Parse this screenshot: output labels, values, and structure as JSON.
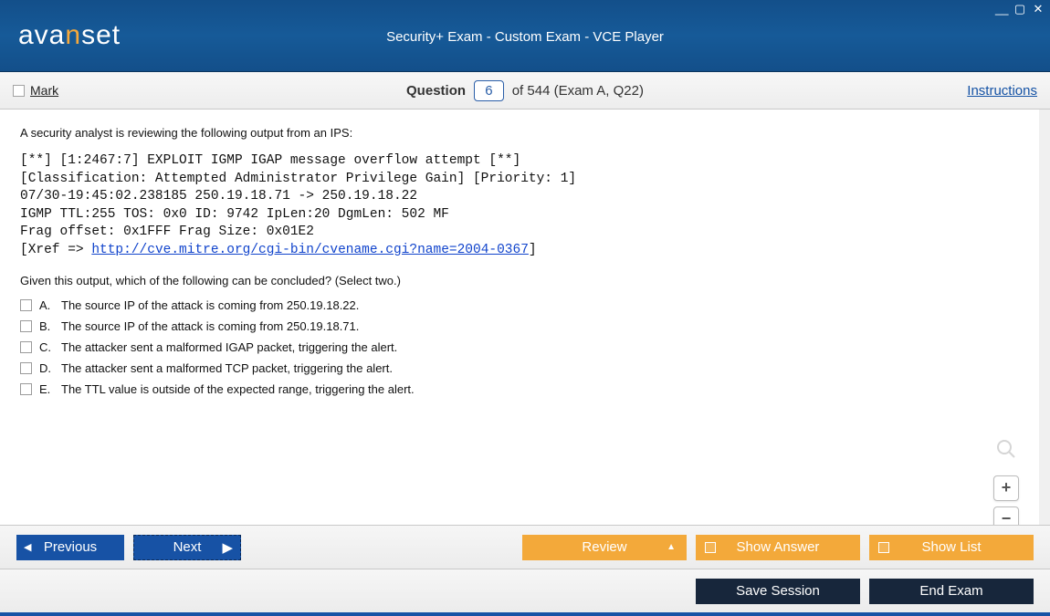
{
  "header": {
    "brand_a": "ava",
    "brand_b": "n",
    "brand_c": "set",
    "title": "Security+ Exam - Custom Exam - VCE Player"
  },
  "toolbar": {
    "mark_label": "Mark",
    "question_word": "Question",
    "question_number": "6",
    "of_text": "of 544 (Exam A, Q22)",
    "instructions_label": "Instructions"
  },
  "question": {
    "stem": "A security analyst is reviewing the following output from an IPS:",
    "ips_lines": {
      "l1": "[**] [1:2467:7] EXPLOIT IGMP IGAP message overflow attempt [**]",
      "l2": "[Classification: Attempted Administrator Privilege Gain] [Priority: 1]",
      "l3": "07/30-19:45:02.238185 250.19.18.71 -> 250.19.18.22",
      "l4": "IGMP TTL:255 TOS: 0x0 ID: 9742 IpLen:20 DgmLen: 502 MF",
      "l5": "Frag offset: 0x1FFF Frag Size: 0x01E2",
      "l6a": "[Xref => ",
      "l6link": "http://cve.mitre.org/cgi-bin/cvename.cgi?name=2004-0367",
      "l6b": "]"
    },
    "sub": "Given this output, which of the following can be concluded? (Select two.)",
    "options": [
      {
        "letter": "A.",
        "text": "The source IP of the attack is coming from 250.19.18.22."
      },
      {
        "letter": "B.",
        "text": "The source IP of the attack is coming from 250.19.18.71."
      },
      {
        "letter": "C.",
        "text": "The attacker sent a malformed IGAP packet, triggering the alert."
      },
      {
        "letter": "D.",
        "text": "The attacker sent a malformed TCP packet, triggering the alert."
      },
      {
        "letter": "E.",
        "text": "The TTL value is outside of the expected range, triggering the alert."
      }
    ]
  },
  "nav": {
    "previous": "Previous",
    "next": "Next",
    "review": "Review",
    "show_answer": "Show Answer",
    "show_list": "Show List"
  },
  "bottom": {
    "save": "Save Session",
    "end": "End Exam"
  },
  "zoom": {
    "plus": "+",
    "minus": "−"
  }
}
